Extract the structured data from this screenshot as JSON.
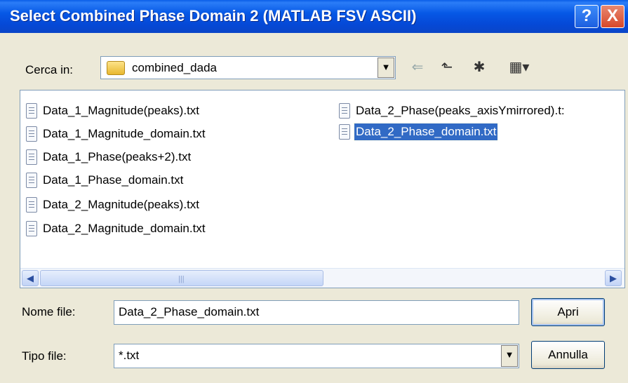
{
  "window": {
    "title": "Select Combined Phase Domain 2 (MATLAB FSV ASCII)",
    "help_glyph": "?",
    "close_glyph": "X"
  },
  "lookin": {
    "label": "Cerca in:",
    "value": "combined_dada",
    "icon": "folder-icon"
  },
  "toolbar": {
    "back_glyph": "⇐",
    "up_glyph": "⬑",
    "newfolder_glyph": "✱",
    "views_glyph": "▦▾"
  },
  "files": [
    {
      "name": "Data_1_Magnitude(peaks).txt",
      "selected": false
    },
    {
      "name": "Data_1_Magnitude_domain.txt",
      "selected": false
    },
    {
      "name": "Data_1_Phase(peaks+2).txt",
      "selected": false
    },
    {
      "name": "Data_1_Phase_domain.txt",
      "selected": false
    },
    {
      "name": "Data_2_Magnitude(peaks).txt",
      "selected": false
    },
    {
      "name": "Data_2_Magnitude_domain.txt",
      "selected": false
    },
    {
      "name": "Data_2_Phase(peaks_axisYmirrored).t:",
      "selected": false
    },
    {
      "name": "Data_2_Phase_domain.txt",
      "selected": true
    }
  ],
  "scroll": {
    "left_glyph": "◀",
    "right_glyph": "▶",
    "grip": "|||"
  },
  "filename": {
    "label": "Nome file:",
    "value": "Data_2_Phase_domain.txt"
  },
  "filetype": {
    "label": "Tipo file:",
    "value": "*.txt"
  },
  "buttons": {
    "open": "Apri",
    "cancel": "Annulla"
  },
  "dropdown_glyph": "▼"
}
